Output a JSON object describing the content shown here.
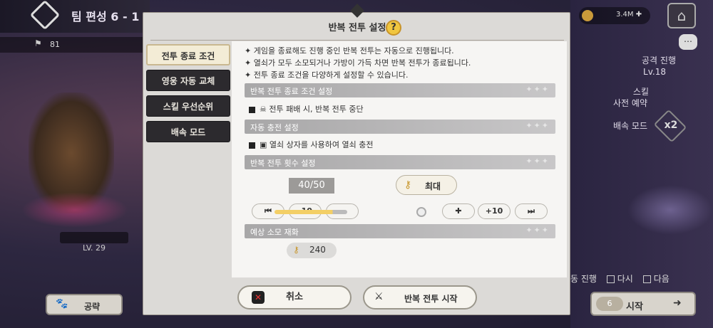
{
  "background": {
    "title": "팀 편성 6 - 1",
    "team_power": "81",
    "gold": "3.4M",
    "side": {
      "attack_label": "공격 진행",
      "attack_level": "Lv.18",
      "skill_label": "스킬",
      "skill_sub": "사전 예약",
      "speed_label": "배속 모드",
      "speed_value": "x2"
    },
    "char_level": "LV. 29",
    "strategy_label": "공략",
    "bottom_options": {
      "progress": "동 진행",
      "again": "다시",
      "next": "다음"
    },
    "start_label": "시작",
    "start_count": "6"
  },
  "modal": {
    "title": "반복 전투 설정",
    "help_icon_text": "?",
    "tabs": [
      {
        "label": "전투 종료 조건",
        "active": true
      },
      {
        "label": "영웅 자동 교체",
        "active": false
      },
      {
        "label": "스킬 우선순위",
        "active": false
      },
      {
        "label": "배속 모드",
        "active": false
      }
    ],
    "notes": [
      "✦ 게임을 종료해도 진행 중인 반복 전투는 자동으로 진행됩니다.",
      "✦ 열쇠가 모두 소모되거나 가방이 가득 차면 반복 전투가 종료됩니다.",
      "✦ 전투 종료 조건을 다양하게 설정할 수 있습니다."
    ],
    "sections": {
      "end_condition": {
        "title": "반복 전투 종료 조건 설정",
        "option": "전투 패배 시, 반복 전투 중단"
      },
      "auto_charge": {
        "title": "자동 충전 설정",
        "option": "열쇠 상자를 사용하여 열쇠 충전"
      },
      "repeat_count": {
        "title": "반복 전투 횟수 설정",
        "current": "40/50",
        "max_label": "최대",
        "minus10": "-10",
        "plus10": "+10",
        "slider_fraction": 0.8
      },
      "expected_cost": {
        "title": "예상 소모 재화",
        "value": "240"
      }
    },
    "buttons": {
      "cancel": "취소",
      "start": "반복 전투 시작"
    }
  }
}
